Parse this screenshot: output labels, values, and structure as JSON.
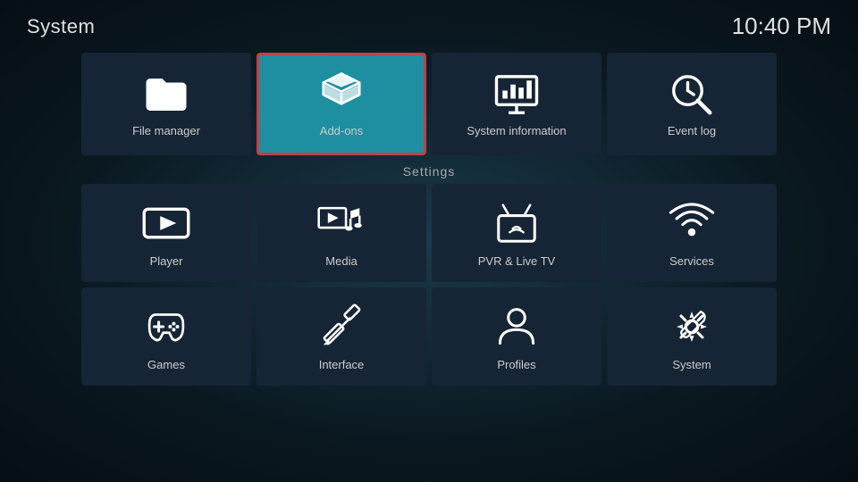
{
  "header": {
    "title": "System",
    "time": "10:40 PM"
  },
  "top_row": [
    {
      "id": "file-manager",
      "label": "File manager",
      "active": false,
      "icon": "folder"
    },
    {
      "id": "add-ons",
      "label": "Add-ons",
      "active": true,
      "icon": "addons"
    },
    {
      "id": "system-information",
      "label": "System information",
      "active": false,
      "icon": "sysinfo"
    },
    {
      "id": "event-log",
      "label": "Event log",
      "active": false,
      "icon": "eventlog"
    }
  ],
  "settings": {
    "title": "Settings",
    "row1": [
      {
        "id": "player",
        "label": "Player",
        "icon": "player"
      },
      {
        "id": "media",
        "label": "Media",
        "icon": "media"
      },
      {
        "id": "pvr-live-tv",
        "label": "PVR & Live TV",
        "icon": "pvr"
      },
      {
        "id": "services",
        "label": "Services",
        "icon": "services"
      }
    ],
    "row2": [
      {
        "id": "games",
        "label": "Games",
        "icon": "games"
      },
      {
        "id": "interface",
        "label": "Interface",
        "icon": "interface"
      },
      {
        "id": "profiles",
        "label": "Profiles",
        "icon": "profiles"
      },
      {
        "id": "system",
        "label": "System",
        "icon": "system"
      }
    ]
  }
}
